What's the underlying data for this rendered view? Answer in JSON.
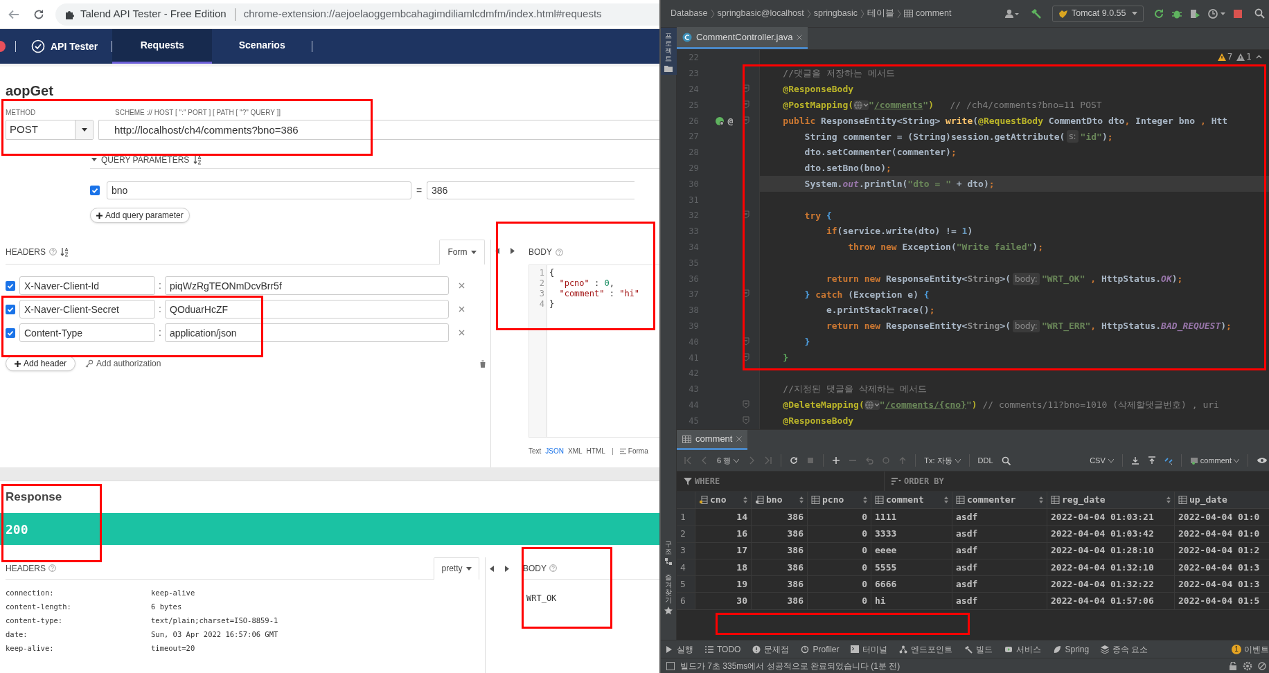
{
  "browser": {
    "page_title": "Talend API Tester - Free Edition",
    "url": "chrome-extension://aejoelaoggembcahagimdiliamlcdmfm/index.html#requests"
  },
  "app_nav": {
    "brand": "API Tester",
    "tabs": [
      {
        "label": "Requests",
        "selected": true
      },
      {
        "label": "Scenarios",
        "selected": false
      }
    ]
  },
  "request": {
    "name": "aopGet",
    "method_label": "METHOD",
    "method": "POST",
    "url_label": "SCHEME :// HOST [ \":\" PORT ] [ PATH [ \"?\" QUERY ]]",
    "url": "http://localhost/ch4/comments?bno=386",
    "query_section": {
      "label": "QUERY PARAMETERS",
      "expanded": true
    },
    "query_params": [
      {
        "checked": true,
        "name": "bno",
        "separator": "=",
        "value": "386"
      }
    ],
    "add_query_button": "Add query parameter",
    "headers_label": "HEADERS",
    "headers_mode": "Form",
    "headers": [
      {
        "checked": true,
        "name": "X-Naver-Client-Id",
        "separator": ":",
        "value": "piqWzRgTEONmDcvBrr5f"
      },
      {
        "checked": true,
        "name": "X-Naver-Client-Secret",
        "separator": ":",
        "value": "QOduarHcZF"
      },
      {
        "checked": true,
        "name": "Content-Type",
        "separator": ":",
        "value": "application/json"
      }
    ],
    "add_header_button": "Add header",
    "add_auth_link": "Add authorization",
    "body_label": "BODY",
    "body_lines": [
      {
        "number": "1",
        "tokens": [
          {
            "kind": "punct",
            "text": "{"
          }
        ]
      },
      {
        "number": "2",
        "tokens": [
          {
            "kind": "key",
            "text": "  \"pcno\""
          },
          {
            "kind": "punct",
            "text": " : "
          },
          {
            "kind": "number",
            "text": "0"
          },
          {
            "kind": "punct",
            "text": ","
          }
        ]
      },
      {
        "number": "3",
        "tokens": [
          {
            "kind": "key",
            "text": "  \"comment\""
          },
          {
            "kind": "punct",
            "text": " : "
          },
          {
            "kind": "string",
            "text": "\"hi\""
          }
        ]
      },
      {
        "number": "4",
        "tokens": [
          {
            "kind": "punct",
            "text": "}"
          }
        ]
      }
    ],
    "body_formats": [
      {
        "label": "Text",
        "selected": false
      },
      {
        "label": "JSON",
        "selected": true
      },
      {
        "label": "XML",
        "selected": false
      },
      {
        "label": "HTML",
        "selected": false
      }
    ],
    "format_button": "Forma"
  },
  "response": {
    "title": "Response",
    "status": "200",
    "headers_label": "HEADERS",
    "view_mode": "pretty",
    "headers": [
      {
        "name": "connection:",
        "value": "keep-alive"
      },
      {
        "name": "content-length:",
        "value": "6 bytes"
      },
      {
        "name": "content-type:",
        "value": "text/plain;charset=ISO-8859-1"
      },
      {
        "name": "date:",
        "value": "Sun, 03 Apr 2022 16:57:06 GMT"
      },
      {
        "name": "keep-alive:",
        "value": "timeout=20"
      }
    ],
    "body_label": "BODY",
    "body": "WRT_OK"
  },
  "ide": {
    "breadcrumbs": [
      "Database",
      "springbasic@localhost",
      "springbasic",
      "테이블",
      "comment"
    ],
    "run_config": "Tomcat 9.0.55",
    "file_tab": {
      "label": "CommentController.java",
      "selected": true
    },
    "inspections": [
      {
        "kind": "warning",
        "count": "7"
      },
      {
        "kind": "weak",
        "count": "1"
      }
    ],
    "side_tools_top": [
      "프로젝트"
    ],
    "side_tools_bottom": [
      "구조",
      "즐겨찾기"
    ],
    "code_lines": [
      {
        "number": "22",
        "fold": false,
        "current": false
      },
      {
        "number": "23",
        "fold": false,
        "current": false,
        "tokens": [
          {
            "kind": "comment",
            "text": "    //댓글을 저장하는 메서드"
          }
        ]
      },
      {
        "number": "24",
        "fold": true,
        "current": false,
        "tokens": [
          {
            "kind": "annotation",
            "text": "    @ResponseBody"
          }
        ]
      },
      {
        "number": "25",
        "fold": true,
        "current": false,
        "tokens": [
          {
            "kind": "annotation",
            "text": "    @PostMapping("
          },
          {
            "kind": "globe"
          },
          {
            "kind": "string",
            "text": "\""
          },
          {
            "kind": "link",
            "text": "/comments"
          },
          {
            "kind": "string",
            "text": "\""
          },
          {
            "kind": "annotation",
            "text": ")"
          },
          {
            "kind": "comment",
            "text": "   // /ch4/comments?bno=11 POST"
          }
        ]
      },
      {
        "number": "26",
        "fold": true,
        "current": false,
        "gutter_mark": "@",
        "tokens": [
          {
            "kind": "keyword",
            "text": "    public "
          },
          {
            "kind": "plain",
            "text": "ResponseEntity<String> "
          },
          {
            "kind": "method",
            "text": "write"
          },
          {
            "kind": "plain",
            "text": "("
          },
          {
            "kind": "annotation",
            "text": "@RequestBody"
          },
          {
            "kind": "plain",
            "text": " CommentDto dto"
          },
          {
            "kind": "keyword",
            "text": ","
          },
          {
            "kind": "plain",
            "text": " Integer bno "
          },
          {
            "kind": "keyword",
            "text": ","
          },
          {
            "kind": "plain",
            "text": " Htt"
          }
        ]
      },
      {
        "number": "27",
        "fold": false,
        "current": false,
        "tokens": [
          {
            "kind": "plain",
            "text": "        String commenter = (String)session.getAttribute("
          },
          {
            "kind": "hint",
            "text": "s:"
          },
          {
            "kind": "string",
            "text": "\"id\""
          },
          {
            "kind": "plain",
            "text": ")"
          },
          {
            "kind": "keyword",
            "text": ";"
          }
        ]
      },
      {
        "number": "28",
        "fold": false,
        "current": false,
        "tokens": [
          {
            "kind": "plain",
            "text": "        dto.setCommenter(commenter)"
          },
          {
            "kind": "keyword",
            "text": ";"
          }
        ]
      },
      {
        "number": "29",
        "fold": false,
        "current": false,
        "tokens": [
          {
            "kind": "plain",
            "text": "        dto.setBno(bno)"
          },
          {
            "kind": "keyword",
            "text": ";"
          }
        ]
      },
      {
        "number": "30",
        "fold": false,
        "current": true,
        "tokens": [
          {
            "kind": "plain",
            "text": "        System."
          },
          {
            "kind": "field",
            "text": "out"
          },
          {
            "kind": "plain",
            "text": ".println("
          },
          {
            "kind": "string",
            "text": "\"dto = \""
          },
          {
            "kind": "plain",
            "text": " + dto)"
          },
          {
            "kind": "keyword",
            "text": ";"
          }
        ]
      },
      {
        "number": "31",
        "fold": false,
        "current": false
      },
      {
        "number": "32",
        "fold": true,
        "current": false,
        "tokens": [
          {
            "kind": "keyword",
            "text": "        try "
          },
          {
            "kind": "brace",
            "text": "{"
          }
        ]
      },
      {
        "number": "33",
        "fold": false,
        "current": false,
        "tokens": [
          {
            "kind": "keyword",
            "text": "            if"
          },
          {
            "kind": "plain",
            "text": "(service.write(dto) != "
          },
          {
            "kind": "number",
            "text": "1"
          },
          {
            "kind": "plain",
            "text": ")"
          }
        ]
      },
      {
        "number": "34",
        "fold": false,
        "current": false,
        "tokens": [
          {
            "kind": "keyword",
            "text": "                throw new "
          },
          {
            "kind": "plain",
            "text": "Exception("
          },
          {
            "kind": "string",
            "text": "\"Write failed\""
          },
          {
            "kind": "plain",
            "text": ")"
          },
          {
            "kind": "keyword",
            "text": ";"
          }
        ]
      },
      {
        "number": "35",
        "fold": false,
        "current": false
      },
      {
        "number": "36",
        "fold": false,
        "current": false,
        "tokens": [
          {
            "kind": "keyword",
            "text": "            return new "
          },
          {
            "kind": "plain",
            "text": "ResponseEntity<"
          },
          {
            "kind": "typeparam",
            "text": "String"
          },
          {
            "kind": "plain",
            "text": ">("
          },
          {
            "kind": "hint",
            "text": "body:"
          },
          {
            "kind": "string",
            "text": "\"WRT_OK\""
          },
          {
            "kind": "keyword",
            "text": " , "
          },
          {
            "kind": "plain",
            "text": "HttpStatus."
          },
          {
            "kind": "field",
            "text": "OK"
          },
          {
            "kind": "plain",
            "text": ")"
          },
          {
            "kind": "keyword",
            "text": ";"
          }
        ]
      },
      {
        "number": "37",
        "fold": true,
        "current": false,
        "tokens": [
          {
            "kind": "brace",
            "text": "        } "
          },
          {
            "kind": "keyword",
            "text": "catch "
          },
          {
            "kind": "plain",
            "text": "(Exception e) "
          },
          {
            "kind": "brace",
            "text": "{"
          }
        ]
      },
      {
        "number": "38",
        "fold": false,
        "current": false,
        "tokens": [
          {
            "kind": "plain",
            "text": "            e.printStackTrace()"
          },
          {
            "kind": "keyword",
            "text": ";"
          }
        ]
      },
      {
        "number": "39",
        "fold": false,
        "current": false,
        "tokens": [
          {
            "kind": "keyword",
            "text": "            return new "
          },
          {
            "kind": "plain",
            "text": "ResponseEntity<"
          },
          {
            "kind": "typeparam",
            "text": "String"
          },
          {
            "kind": "plain",
            "text": ">("
          },
          {
            "kind": "hint",
            "text": "body:"
          },
          {
            "kind": "string",
            "text": "\"WRT_ERR\""
          },
          {
            "kind": "keyword",
            "text": ", "
          },
          {
            "kind": "plain",
            "text": "HttpStatus."
          },
          {
            "kind": "field",
            "text": "BAD_REQUEST"
          },
          {
            "kind": "plain",
            "text": ")"
          },
          {
            "kind": "keyword",
            "text": ";"
          }
        ]
      },
      {
        "number": "40",
        "fold": true,
        "current": false,
        "tokens": [
          {
            "kind": "brace",
            "text": "        }"
          }
        ]
      },
      {
        "number": "41",
        "fold": true,
        "current": false,
        "tokens": [
          {
            "kind": "outerbrace",
            "text": "    }"
          }
        ]
      },
      {
        "number": "42",
        "fold": false,
        "current": false
      },
      {
        "number": "43",
        "fold": false,
        "current": false,
        "tokens": [
          {
            "kind": "comment",
            "text": "    //지정된 댓글을 삭제하는 메서드"
          }
        ]
      },
      {
        "number": "44",
        "fold": true,
        "current": false,
        "tokens": [
          {
            "kind": "annotation",
            "text": "    @DeleteMapping("
          },
          {
            "kind": "globe"
          },
          {
            "kind": "string",
            "text": "\""
          },
          {
            "kind": "link",
            "text": "/comments/{cno}"
          },
          {
            "kind": "string",
            "text": "\""
          },
          {
            "kind": "annotation",
            "text": ")"
          },
          {
            "kind": "comment",
            "text": " // comments/11?bno=1010 (삭제할댓글번호) , uri"
          }
        ]
      },
      {
        "number": "45",
        "fold": true,
        "current": false,
        "tokens": [
          {
            "kind": "annotation",
            "text": "    @ResponseBody"
          }
        ]
      }
    ],
    "results": {
      "tab": "comment",
      "page_size": "6 행",
      "tx_mode": "Tx: 자동",
      "ddl": "DDL",
      "export_format": "CSV",
      "table_selector": "comment",
      "where_label": "WHERE",
      "order_label": "ORDER BY",
      "columns": [
        {
          "name": "cno",
          "kind": "primary",
          "numeric": true
        },
        {
          "name": "bno",
          "kind": "foreign",
          "numeric": true
        },
        {
          "name": "pcno",
          "kind": "plain",
          "numeric": true
        },
        {
          "name": "comment",
          "kind": "plain",
          "numeric": false
        },
        {
          "name": "commenter",
          "kind": "plain",
          "numeric": false
        },
        {
          "name": "reg_date",
          "kind": "plain",
          "numeric": false
        },
        {
          "name": "up_date",
          "kind": "plain",
          "numeric": false
        }
      ],
      "rows": [
        {
          "number": "1",
          "cells": [
            "14",
            "386",
            "0",
            "1111",
            "asdf",
            "2022-04-04 01:03:21",
            "2022-04-04 01:0"
          ]
        },
        {
          "number": "2",
          "cells": [
            "16",
            "386",
            "0",
            "3333",
            "asdf",
            "2022-04-04 01:03:42",
            "2022-04-04 01:0"
          ]
        },
        {
          "number": "3",
          "cells": [
            "17",
            "386",
            "0",
            "eeee",
            "asdf",
            "2022-04-04 01:28:10",
            "2022-04-04 01:2"
          ]
        },
        {
          "number": "4",
          "cells": [
            "18",
            "386",
            "0",
            "5555",
            "asdf",
            "2022-04-04 01:32:10",
            "2022-04-04 01:3"
          ]
        },
        {
          "number": "5",
          "cells": [
            "19",
            "386",
            "0",
            "6666",
            "asdf",
            "2022-04-04 01:32:22",
            "2022-04-04 01:3"
          ]
        },
        {
          "number": "6",
          "cells": [
            "30",
            "386",
            "0",
            "hi",
            "asdf",
            "2022-04-04 01:57:06",
            "2022-04-04 01:5"
          ]
        }
      ]
    },
    "tool_windows": [
      {
        "kind": "run",
        "label": "실행"
      },
      {
        "kind": "todo",
        "label": "TODO"
      },
      {
        "kind": "problems",
        "label": "문제점"
      },
      {
        "kind": "profiler",
        "label": "Profiler"
      },
      {
        "kind": "terminal",
        "label": "터미널"
      },
      {
        "kind": "endpoints",
        "label": "엔드포인트"
      },
      {
        "kind": "build",
        "label": "빌드"
      },
      {
        "kind": "services",
        "label": "서비스"
      },
      {
        "kind": "spring",
        "label": "Spring"
      },
      {
        "kind": "dependencies",
        "label": "종속 요소"
      }
    ],
    "event_log": {
      "count": "1",
      "label": "이벤트"
    },
    "status": "빌드가 7초 335ms에서 성공적으로 완료되었습니다 (1분 전)"
  }
}
